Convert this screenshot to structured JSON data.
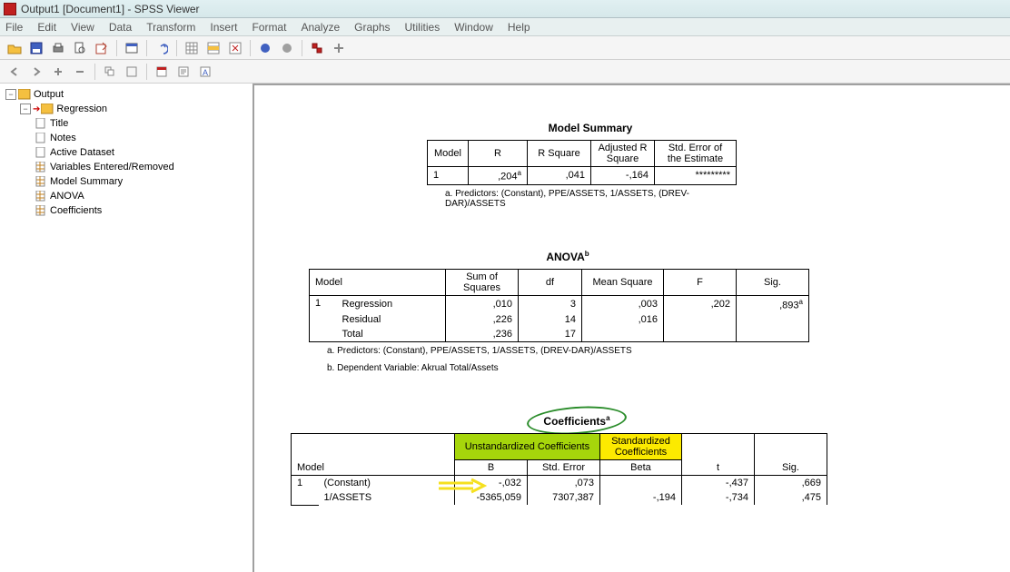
{
  "window": {
    "title": "Output1 [Document1] - SPSS Viewer"
  },
  "menus": {
    "file": "File",
    "edit": "Edit",
    "view": "View",
    "data": "Data",
    "transform": "Transform",
    "insert": "Insert",
    "format": "Format",
    "analyze": "Analyze",
    "graphs": "Graphs",
    "utilities": "Utilities",
    "window": "Window",
    "help": "Help"
  },
  "outline": {
    "root": "Output",
    "regression": "Regression",
    "items": {
      "title": "Title",
      "notes": "Notes",
      "activeDataset": "Active Dataset",
      "varsEntered": "Variables Entered/Removed",
      "modelSummary": "Model Summary",
      "anova": "ANOVA",
      "coefficients": "Coefficients"
    }
  },
  "modelSummary": {
    "title": "Model Summary",
    "headers": {
      "model": "Model",
      "r": "R",
      "rsq": "R Square",
      "adjRsq": "Adjusted R Square",
      "stdErr": "Std. Error of the Estimate"
    },
    "row": {
      "model": "1",
      "r": ",204",
      "rSup": "a",
      "rsq": ",041",
      "adjRsq": "-,164",
      "stdErr": "*********"
    },
    "footnote": "a.  Predictors: (Constant), PPE/ASSETS, 1/ASSETS, (DREV-DAR)/ASSETS"
  },
  "anova": {
    "title": "ANOVA",
    "titleSup": "b",
    "headers": {
      "model": "Model",
      "ss": "Sum of Squares",
      "df": "df",
      "ms": "Mean Square",
      "f": "F",
      "sig": "Sig."
    },
    "rows": {
      "regression": {
        "label": "Regression",
        "ss": ",010",
        "df": "3",
        "ms": ",003",
        "f": ",202",
        "sig": ",893",
        "sigSup": "a"
      },
      "residual": {
        "label": "Residual",
        "ss": ",226",
        "df": "14",
        "ms": ",016",
        "f": "",
        "sig": ""
      },
      "total": {
        "label": "Total",
        "ss": ",236",
        "df": "17",
        "ms": "",
        "f": "",
        "sig": ""
      }
    },
    "model": "1",
    "footnoteA": "a.  Predictors: (Constant), PPE/ASSETS, 1/ASSETS, (DREV-DAR)/ASSETS",
    "footnoteB": "b.  Dependent Variable: Akrual Total/Assets"
  },
  "coefficients": {
    "title": "Coefficients",
    "titleSup": "a",
    "headers": {
      "model": "Model",
      "unstd": "Unstandardized Coefficients",
      "std": "Standardized Coefficients",
      "b": "B",
      "stdErr": "Std. Error",
      "beta": "Beta",
      "t": "t",
      "sig": "Sig."
    },
    "model": "1",
    "rows": {
      "constant": {
        "label": "(Constant)",
        "b": "-,032",
        "stdErr": ",073",
        "beta": "",
        "t": "-,437",
        "sig": ",669"
      },
      "assets": {
        "label": "1/ASSETS",
        "b": "-5365,059",
        "stdErr": "7307,387",
        "beta": "-,194",
        "t": "-,734",
        "sig": ",475"
      }
    }
  }
}
